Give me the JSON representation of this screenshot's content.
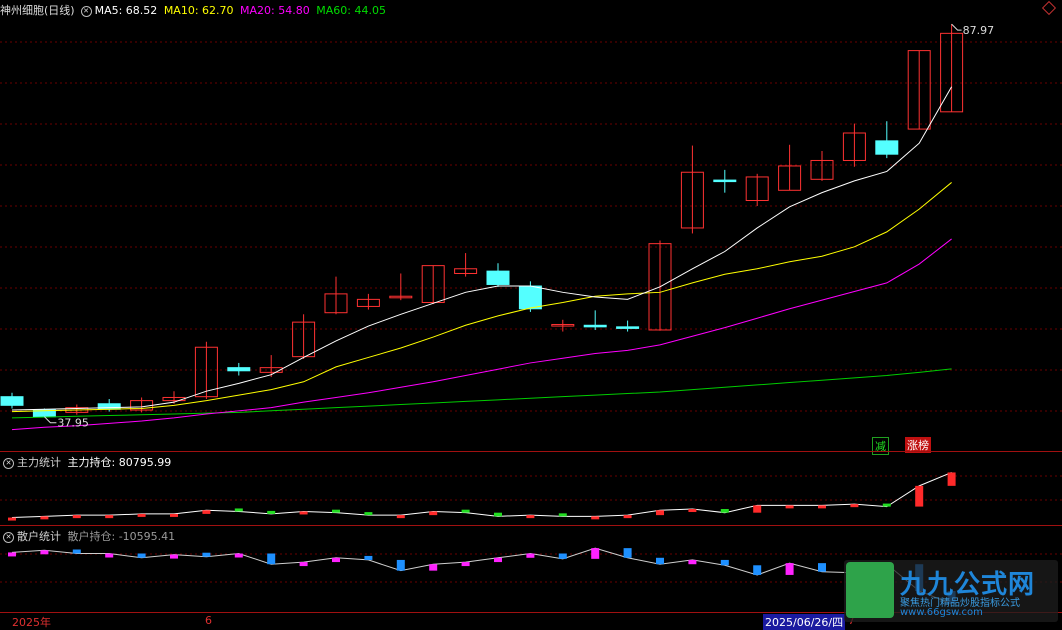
{
  "main": {
    "title": "神州细胞(日线)",
    "ma5": "MA5: 68.52",
    "ma10": "MA10: 62.70",
    "ma20": "MA20: 54.80",
    "ma60": "MA60: 44.05",
    "high_label": "87.97",
    "low_label": "37.95",
    "tag_reduce": "减",
    "tag_limitup": "涨榜",
    "colors": {
      "up": "#ff3232",
      "down": "#54ffff",
      "ma5": "#ffffff",
      "ma10": "#ffff00",
      "ma20": "#ff00ff",
      "ma60": "#00cc00"
    }
  },
  "mid": {
    "indicator": "主力统计",
    "value": "主力持仓: 80795.99"
  },
  "low": {
    "indicator": "散户统计",
    "value": "散户持仓: -10595.41"
  },
  "axis": {
    "year": "2025年",
    "month": "6",
    "cursor_date": "2025/06/26/四",
    "cursor_extra": "7"
  },
  "watermark": {
    "brand": "九九公式网",
    "slogan": "聚焦热门精品炒股指标公式",
    "url": "www.66gsw.com"
  },
  "candles": [
    {
      "o": 40.5,
      "c": 39.4,
      "h": 41.0,
      "l": 39.0
    },
    {
      "o": 38.8,
      "c": 37.95,
      "h": 39.0,
      "l": 37.95
    },
    {
      "o": 38.5,
      "c": 39.1,
      "h": 39.5,
      "l": 38.2
    },
    {
      "o": 39.6,
      "c": 38.9,
      "h": 40.2,
      "l": 38.6
    },
    {
      "o": 38.8,
      "c": 40.0,
      "h": 40.4,
      "l": 38.5
    },
    {
      "o": 40.0,
      "c": 40.4,
      "h": 41.2,
      "l": 39.6
    },
    {
      "o": 40.5,
      "c": 46.8,
      "h": 47.5,
      "l": 40.2
    },
    {
      "o": 44.2,
      "c": 43.8,
      "h": 44.8,
      "l": 43.2
    },
    {
      "o": 43.6,
      "c": 44.2,
      "h": 45.8,
      "l": 43.0
    },
    {
      "o": 45.6,
      "c": 50.0,
      "h": 51.0,
      "l": 45.3
    },
    {
      "o": 51.2,
      "c": 53.6,
      "h": 55.8,
      "l": 51.0
    },
    {
      "o": 52.0,
      "c": 52.9,
      "h": 53.6,
      "l": 51.6
    },
    {
      "o": 53.1,
      "c": 53.3,
      "h": 56.2,
      "l": 52.8
    },
    {
      "o": 52.5,
      "c": 57.2,
      "h": 57.2,
      "l": 52.3
    },
    {
      "o": 56.2,
      "c": 56.8,
      "h": 58.8,
      "l": 55.8
    },
    {
      "o": 56.5,
      "c": 54.8,
      "h": 57.5,
      "l": 54.5
    },
    {
      "o": 54.6,
      "c": 51.7,
      "h": 55.2,
      "l": 51.3
    },
    {
      "o": 49.5,
      "c": 49.7,
      "h": 50.3,
      "l": 48.8
    },
    {
      "o": 49.6,
      "c": 49.4,
      "h": 51.5,
      "l": 49.0
    },
    {
      "o": 49.4,
      "c": 49.2,
      "h": 50.2,
      "l": 48.8
    },
    {
      "o": 49.0,
      "c": 60.0,
      "h": 60.4,
      "l": 48.9
    },
    {
      "o": 62.0,
      "c": 69.1,
      "h": 72.5,
      "l": 61.3
    },
    {
      "o": 68.1,
      "c": 68.0,
      "h": 69.4,
      "l": 66.5
    },
    {
      "o": 65.5,
      "c": 68.5,
      "h": 68.9,
      "l": 64.8
    },
    {
      "o": 66.8,
      "c": 69.9,
      "h": 72.6,
      "l": 66.8
    },
    {
      "o": 68.2,
      "c": 70.6,
      "h": 71.8,
      "l": 68.0
    },
    {
      "o": 70.6,
      "c": 74.1,
      "h": 75.3,
      "l": 69.8
    },
    {
      "o": 73.1,
      "c": 71.4,
      "h": 75.6,
      "l": 70.9
    },
    {
      "o": 74.6,
      "c": 84.6,
      "h": 84.6,
      "l": 74.6
    },
    {
      "o": 76.8,
      "c": 86.8,
      "h": 87.97,
      "l": 76.8
    }
  ],
  "ma_lines": {
    "ma5": [
      38.8,
      38.9,
      39.0,
      39.1,
      39.2,
      39.8,
      41.2,
      42.2,
      43.3,
      45.5,
      47.6,
      49.5,
      51.0,
      52.4,
      53.8,
      54.6,
      54.6,
      53.8,
      53.2,
      52.9,
      54.5,
      56.8,
      59.0,
      62.0,
      64.7,
      66.5,
      68.0,
      69.2,
      72.8,
      80.0
    ],
    "ma10": [
      38.6,
      38.7,
      38.8,
      38.9,
      39.0,
      39.4,
      40.0,
      40.7,
      41.4,
      42.4,
      44.3,
      45.5,
      46.7,
      48.1,
      49.6,
      50.8,
      51.8,
      52.5,
      53.3,
      53.6,
      53.8,
      55.0,
      56.1,
      56.8,
      57.7,
      58.4,
      59.6,
      61.5,
      64.4,
      67.8
    ],
    "ma20": [
      36.3,
      36.6,
      36.8,
      37.1,
      37.4,
      37.8,
      38.3,
      38.7,
      39.1,
      39.8,
      40.4,
      41.0,
      41.7,
      42.4,
      43.2,
      44.0,
      44.8,
      45.4,
      46.0,
      46.4,
      47.1,
      48.2,
      49.3,
      50.5,
      51.7,
      52.8,
      53.9,
      55.0,
      57.4,
      60.6
    ],
    "ma60": [
      37.8,
      37.9,
      38.0,
      38.1,
      38.2,
      38.3,
      38.4,
      38.5,
      38.7,
      38.9,
      39.1,
      39.3,
      39.5,
      39.7,
      39.9,
      40.1,
      40.3,
      40.5,
      40.7,
      40.9,
      41.1,
      41.4,
      41.7,
      42.0,
      42.3,
      42.6,
      42.9,
      43.2,
      43.6,
      44.05
    ]
  },
  "main_force": [
    -6,
    -5,
    -4,
    -4,
    -3,
    -3,
    0,
    -1,
    -3,
    -1,
    -2,
    -4,
    -4,
    -1,
    -2,
    -5,
    -4,
    -5,
    -5,
    -4,
    0,
    1,
    -2,
    4,
    4,
    4,
    5,
    3,
    20,
    31
  ],
  "retail": [
    8,
    10,
    7,
    7,
    3,
    6,
    4,
    7,
    -3,
    -1,
    3,
    1,
    -9,
    -3,
    -1,
    3,
    7,
    2,
    12,
    3,
    -3,
    1,
    -4,
    -13,
    -2,
    -10,
    -11,
    -3,
    -28,
    -40
  ]
}
